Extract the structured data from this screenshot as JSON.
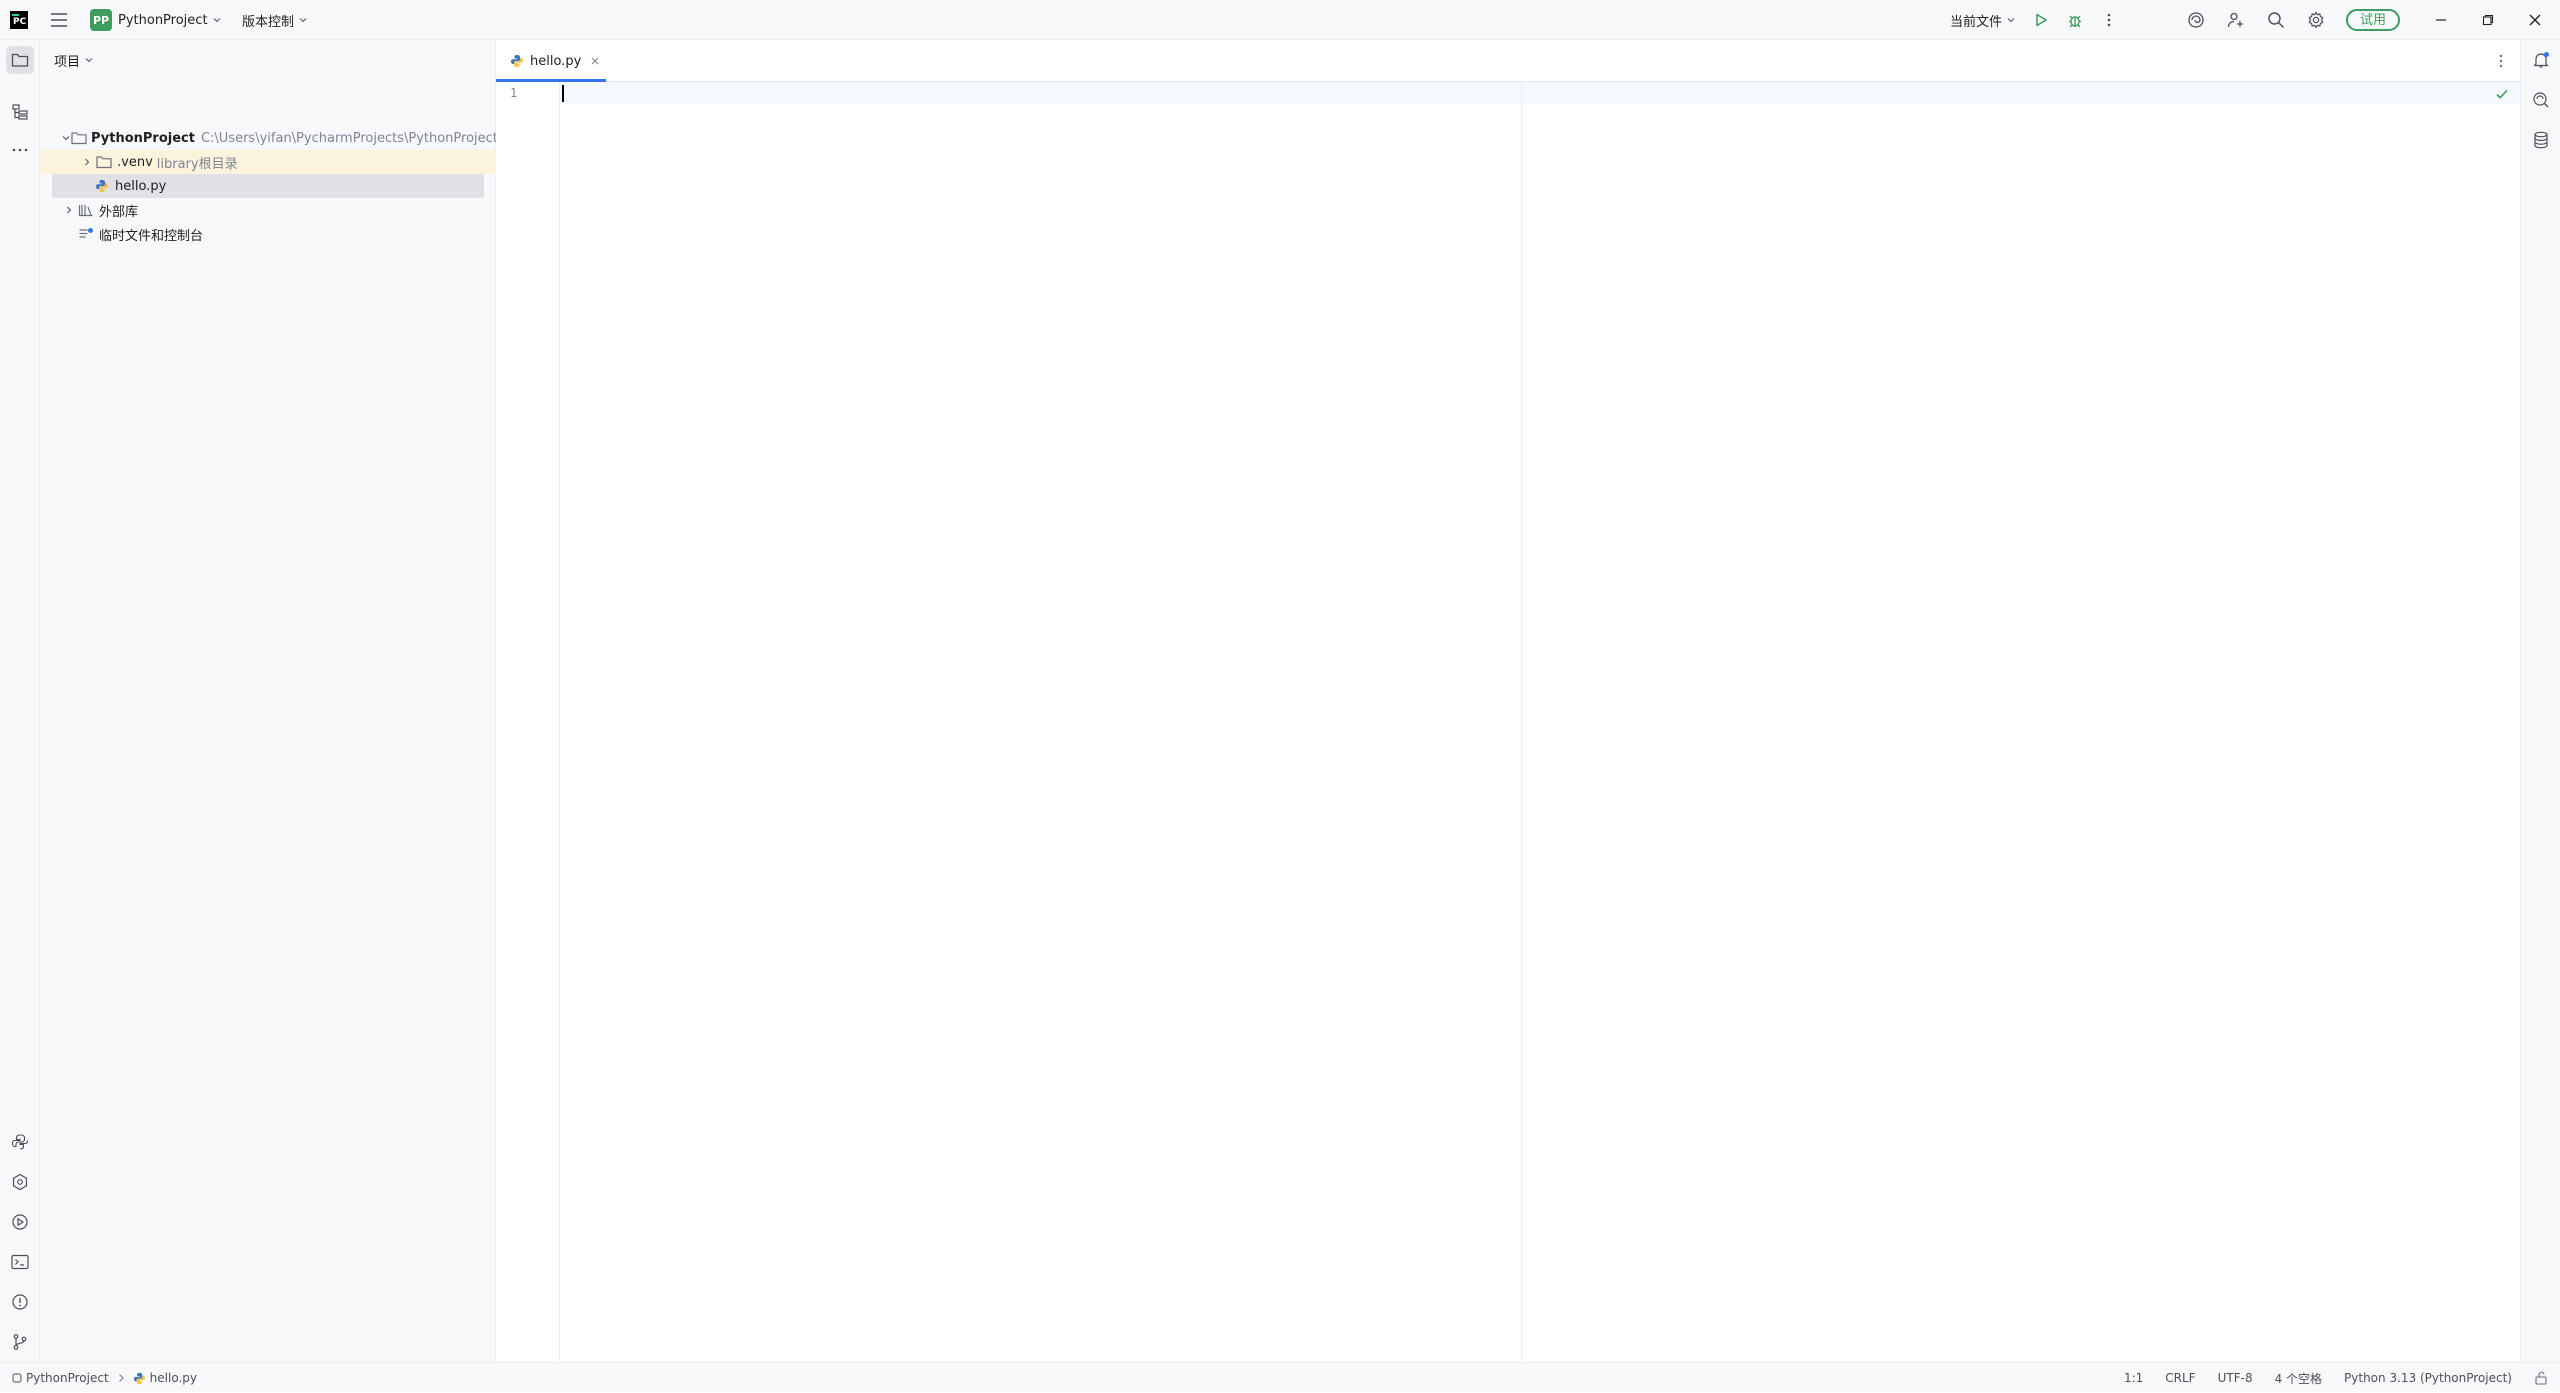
{
  "titlebar": {
    "project_badge": "PP",
    "project_name": "PythonProject",
    "vcs_label": "版本控制",
    "run_config": "当前文件",
    "trial_label": "试用"
  },
  "project_panel": {
    "header": "项目",
    "tree": [
      {
        "label": "PythonProject",
        "hint": "C:\\Users\\yifan\\PycharmProjects\\PythonProject"
      },
      {
        "label": ".venv",
        "hint": "library根目录"
      },
      {
        "label": "hello.py"
      },
      {
        "label": "外部库"
      },
      {
        "label": "临时文件和控制台"
      }
    ]
  },
  "editor": {
    "tab_label": "hello.py",
    "line_numbers": [
      "1"
    ]
  },
  "statusbar": {
    "breadcrumb": [
      "PythonProject",
      "hello.py"
    ],
    "position": "1:1",
    "line_separator": "CRLF",
    "encoding": "UTF-8",
    "indent": "4 个空格",
    "interpreter": "Python 3.13 (PythonProject)"
  },
  "colors": {
    "accent": "#3574f0",
    "project_badge": "#3d9c5e",
    "trial": "#3d9c5e",
    "excluded_row": "#fbf3dc",
    "selected_row": "#dfe1e5"
  }
}
